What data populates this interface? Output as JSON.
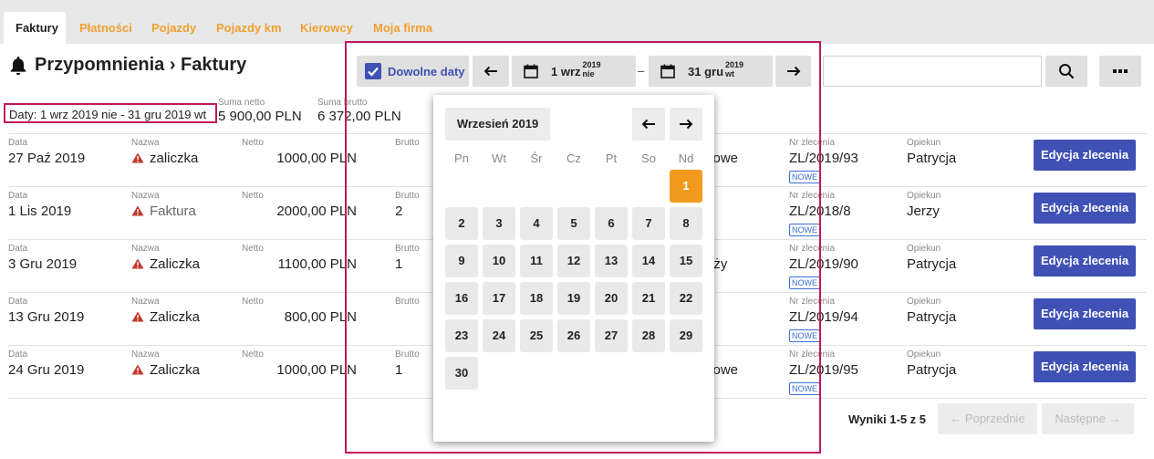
{
  "tabs": [
    {
      "label": "Faktury",
      "active": true
    },
    {
      "label": "Płatności"
    },
    {
      "label": "Pojazdy"
    },
    {
      "label": "Pojazdy km"
    },
    {
      "label": "Kierowcy"
    },
    {
      "label": "Moja firma"
    }
  ],
  "page": {
    "title": "Przypomnienia › Faktury"
  },
  "filter_badge": "Daty: 1 wrz 2019 nie - 31 gru 2019 wt",
  "summary": {
    "net_label": "Suma netto",
    "net_value": "5 900,00 PLN",
    "gross_label": "Suma brutto",
    "gross_value": "6 372,00 PLN"
  },
  "column_labels": {
    "date": "Data",
    "name": "Nazwa",
    "net": "Netto",
    "gross": "Brutto",
    "order_no": "Nr zlecenia",
    "guardian": "Opiekun"
  },
  "rows": [
    {
      "date": "27 Paź 2019",
      "name": "zaliczka",
      "net": "1000,00 PLN",
      "gross_partial": "",
      "hidden_partial": "kowe",
      "order_no": "ZL/2019/93",
      "badge": "NOWE",
      "guardian": "Patrycja",
      "action": "Edycja zlecenia"
    },
    {
      "date": "1 Lis 2019",
      "name": "Faktura",
      "net": "2000,00 PLN",
      "gross_partial": "2",
      "hidden_partial": "",
      "order_no": "ZL/2018/8",
      "badge": "NOWE",
      "guardian": "Jerzy",
      "action": "Edycja zlecenia"
    },
    {
      "date": "3 Gru 2019",
      "name": "Zaliczka",
      "net": "1100,00 PLN",
      "gross_partial": "1",
      "hidden_partial": "óży",
      "order_no": "ZL/2019/90",
      "badge": "NOWE",
      "guardian": "Patrycja",
      "action": "Edycja zlecenia"
    },
    {
      "date": "13 Gru 2019",
      "name": "Zaliczka",
      "net": "800,00 PLN",
      "gross_partial": "",
      "hidden_partial": "",
      "order_no": "ZL/2019/94",
      "badge": "NOWE",
      "guardian": "Patrycja",
      "action": "Edycja zlecenia"
    },
    {
      "date": "24 Gru 2019",
      "name": "Zaliczka",
      "net": "1000,00 PLN",
      "gross_partial": "1",
      "hidden_partial": "kowe",
      "order_no": "ZL/2019/95",
      "badge": "NOWE",
      "guardian": "Patrycja",
      "action": "Edycja zlecenia"
    }
  ],
  "date_range": {
    "any_dates_label": "Dowolne daty",
    "any_dates_checked": true,
    "start": {
      "day": "1 wrz",
      "year": "2019",
      "weekday": "nie"
    },
    "end": {
      "day": "31 gru",
      "year": "2019",
      "weekday": "wt"
    },
    "separator": "–"
  },
  "search": {
    "value": "",
    "placeholder": ""
  },
  "calendar": {
    "month_title": "Wrzesień 2019",
    "weekdays": [
      "Pn",
      "Wt",
      "Śr",
      "Cz",
      "Pt",
      "So",
      "Nd"
    ],
    "first_weekday_index": 6,
    "days_in_month": 30,
    "selected_day": 1
  },
  "pagination": {
    "results": "Wyniki 1-5 z 5",
    "prev": "← Poprzednie",
    "next": "Następne →"
  },
  "colors": {
    "accent": "#3f51b5",
    "tab_orange": "#f0a030",
    "selected_day": "#f39a1e",
    "highlight_border": "#c2185b"
  },
  "icons": [
    "bell-icon",
    "warning-icon",
    "calendar-icon",
    "arrow-left-icon",
    "arrow-right-icon",
    "search-icon",
    "more-icon",
    "check-icon"
  ]
}
